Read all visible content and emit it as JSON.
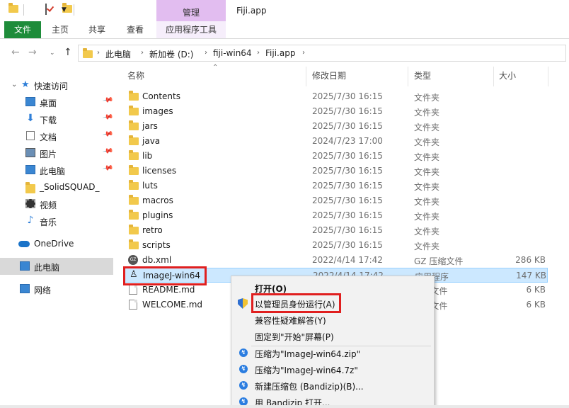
{
  "window": {
    "title": "Fiji.app",
    "context_tab_group": "管理"
  },
  "ribbon": {
    "tabs": [
      "文件",
      "主页",
      "共享",
      "查看",
      "应用程序工具"
    ]
  },
  "address": {
    "breadcrumbs": [
      "此电脑",
      "新加卷 (D:)",
      "fiji-win64",
      "Fiji.app"
    ]
  },
  "sidebar": {
    "items": [
      {
        "label": "快速访问",
        "icon": "star-icon"
      },
      {
        "label": "桌面",
        "icon": "desktop-icon",
        "pinned": true
      },
      {
        "label": "下载",
        "icon": "download-icon",
        "pinned": true
      },
      {
        "label": "文档",
        "icon": "document-icon",
        "pinned": true
      },
      {
        "label": "图片",
        "icon": "picture-icon",
        "pinned": true
      },
      {
        "label": "此电脑",
        "icon": "computer-icon",
        "pinned": true
      },
      {
        "label": "_SolidSQUAD_",
        "icon": "folder-icon"
      },
      {
        "label": "视频",
        "icon": "video-icon"
      },
      {
        "label": "音乐",
        "icon": "music-icon"
      },
      {
        "label": "OneDrive",
        "icon": "cloud-icon"
      },
      {
        "label": "此电脑",
        "icon": "computer-icon",
        "selected": true
      },
      {
        "label": "网络",
        "icon": "network-icon"
      }
    ]
  },
  "columns": {
    "name": "名称",
    "date": "修改日期",
    "type": "类型",
    "size": "大小"
  },
  "files": [
    {
      "name": "Contents",
      "date": "2025/7/30 16:15",
      "type": "文件夹",
      "size": "",
      "kind": "folder"
    },
    {
      "name": "images",
      "date": "2025/7/30 16:15",
      "type": "文件夹",
      "size": "",
      "kind": "folder"
    },
    {
      "name": "jars",
      "date": "2025/7/30 16:15",
      "type": "文件夹",
      "size": "",
      "kind": "folder"
    },
    {
      "name": "java",
      "date": "2024/7/23 17:00",
      "type": "文件夹",
      "size": "",
      "kind": "folder"
    },
    {
      "name": "lib",
      "date": "2025/7/30 16:15",
      "type": "文件夹",
      "size": "",
      "kind": "folder"
    },
    {
      "name": "licenses",
      "date": "2025/7/30 16:15",
      "type": "文件夹",
      "size": "",
      "kind": "folder"
    },
    {
      "name": "luts",
      "date": "2025/7/30 16:15",
      "type": "文件夹",
      "size": "",
      "kind": "folder"
    },
    {
      "name": "macros",
      "date": "2025/7/30 16:15",
      "type": "文件夹",
      "size": "",
      "kind": "folder"
    },
    {
      "name": "plugins",
      "date": "2025/7/30 16:15",
      "type": "文件夹",
      "size": "",
      "kind": "folder"
    },
    {
      "name": "retro",
      "date": "2025/7/30 16:15",
      "type": "文件夹",
      "size": "",
      "kind": "folder"
    },
    {
      "name": "scripts",
      "date": "2025/7/30 16:15",
      "type": "文件夹",
      "size": "",
      "kind": "folder"
    },
    {
      "name": "db.xml",
      "date": "2022/4/14 17:42",
      "type": "GZ 压缩文件",
      "size": "286 KB",
      "kind": "gz"
    },
    {
      "name": "ImageJ-win64",
      "date": "2022/4/14 17:42",
      "type": "应用程序",
      "size": "147 KB",
      "kind": "app",
      "selected": true
    },
    {
      "name": "README.md",
      "date": "",
      "type": "MD 文件",
      "size": "6 KB",
      "kind": "file"
    },
    {
      "name": "WELCOME.md",
      "date": "",
      "type": "MD 文件",
      "size": "6 KB",
      "kind": "file"
    }
  ],
  "context_menu": {
    "items": [
      {
        "label": "打开(O)",
        "bold": true
      },
      {
        "label": "以管理员身份运行(A)",
        "icon": "shield-icon"
      },
      {
        "label": "兼容性疑难解答(Y)"
      },
      {
        "label": "固定到\"开始\"屏幕(P)"
      },
      {
        "label": "压缩为\"ImageJ-win64.zip\"",
        "icon": "bandizip-icon"
      },
      {
        "label": "压缩为\"ImageJ-win64.7z\"",
        "icon": "bandizip-icon"
      },
      {
        "label": "新建压缩包 (Bandizip)(B)...",
        "icon": "bandizip-icon"
      },
      {
        "label": "用 Bandizip 打开...",
        "icon": "bandizip-icon"
      }
    ]
  },
  "colors": {
    "file_tab": "#1e8c3a",
    "manage_band": "#e2bdf0",
    "selection": "#cce8ff",
    "highlight_box": "#e01f1f"
  }
}
